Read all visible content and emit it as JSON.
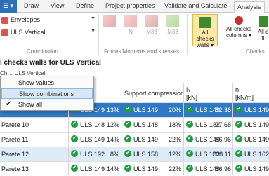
{
  "tabs": {
    "file_label": "☰ ▾",
    "items": [
      "Draw",
      "View",
      "Define",
      "Project properties",
      "Validate and Calculate",
      "Analysis"
    ],
    "active": "Analysis"
  },
  "ribbon": {
    "combination": {
      "envelopes_label": "Envelopes",
      "uls_label": "ULS Vertical",
      "group_label": "Combination"
    },
    "forces": {
      "buttons": [
        "",
        "N",
        "M33",
        "M33"
      ],
      "group_label": "Forces/Moments and stresses"
    },
    "checks": {
      "buttons": [
        {
          "label": "All checks walls ▾",
          "selected": true
        },
        {
          "label": "All checks columns ▾",
          "selected": false
        },
        {
          "label": "All c fl",
          "selected": false
        }
      ],
      "group_label": "Checks"
    }
  },
  "title": "l checks walls for ULS Vertical",
  "filter_text": "Ch… ULS Vertical",
  "menu": {
    "items": [
      {
        "label": "Show values",
        "checked": false,
        "hover": false
      },
      {
        "label": "Show combinations",
        "checked": false,
        "hover": true
      },
      {
        "label": "Show all",
        "checked": true,
        "hover": false
      }
    ]
  },
  "grid": {
    "headers": {
      "support": "Support compression",
      "n": "N",
      "n_unit": "[kN]",
      "n2": "n",
      "n2_unit": "[kN/m]"
    },
    "rows": [
      {
        "name": "",
        "c1": "ULS 149",
        "p1": "13%",
        "c2": "ULS 149",
        "p2": "20%",
        "c3": "ULS 149",
        "v3": "82.36",
        "c4": "ULS 149",
        "v4": "",
        "style": "sel"
      },
      {
        "name": "Parete 10",
        "c1": "ULS 148",
        "p1": "12%",
        "c2": "ULS 148",
        "p2": "18%",
        "c3": "ULS 182",
        "v3": "77.68",
        "c4": "ULS 149",
        "v4": "",
        "style": ""
      },
      {
        "name": "Parete 11",
        "c1": "ULS 149",
        "p1": "14%",
        "c2": "ULS 149",
        "p2": "22%",
        "c3": "ULS 149",
        "v3": "86.96",
        "c4": "ULS 149",
        "v4": "",
        "style": ""
      },
      {
        "name": "Parete 12",
        "c1": "ULS 192",
        "p1": "8%",
        "c2": "ULS 158",
        "p2": "12%",
        "c3": "ULS 162",
        "v3": "208.11",
        "c4": "ULS 162",
        "v4": "",
        "style": "alt"
      },
      {
        "name": "Parete 13",
        "c1": "ULS 149",
        "p1": "14%",
        "c2": "ULS 149",
        "p2": "22%",
        "c3": "ULS 149",
        "v3": "86.96",
        "c4": "ULS 149",
        "v4": "",
        "style": ""
      }
    ]
  }
}
